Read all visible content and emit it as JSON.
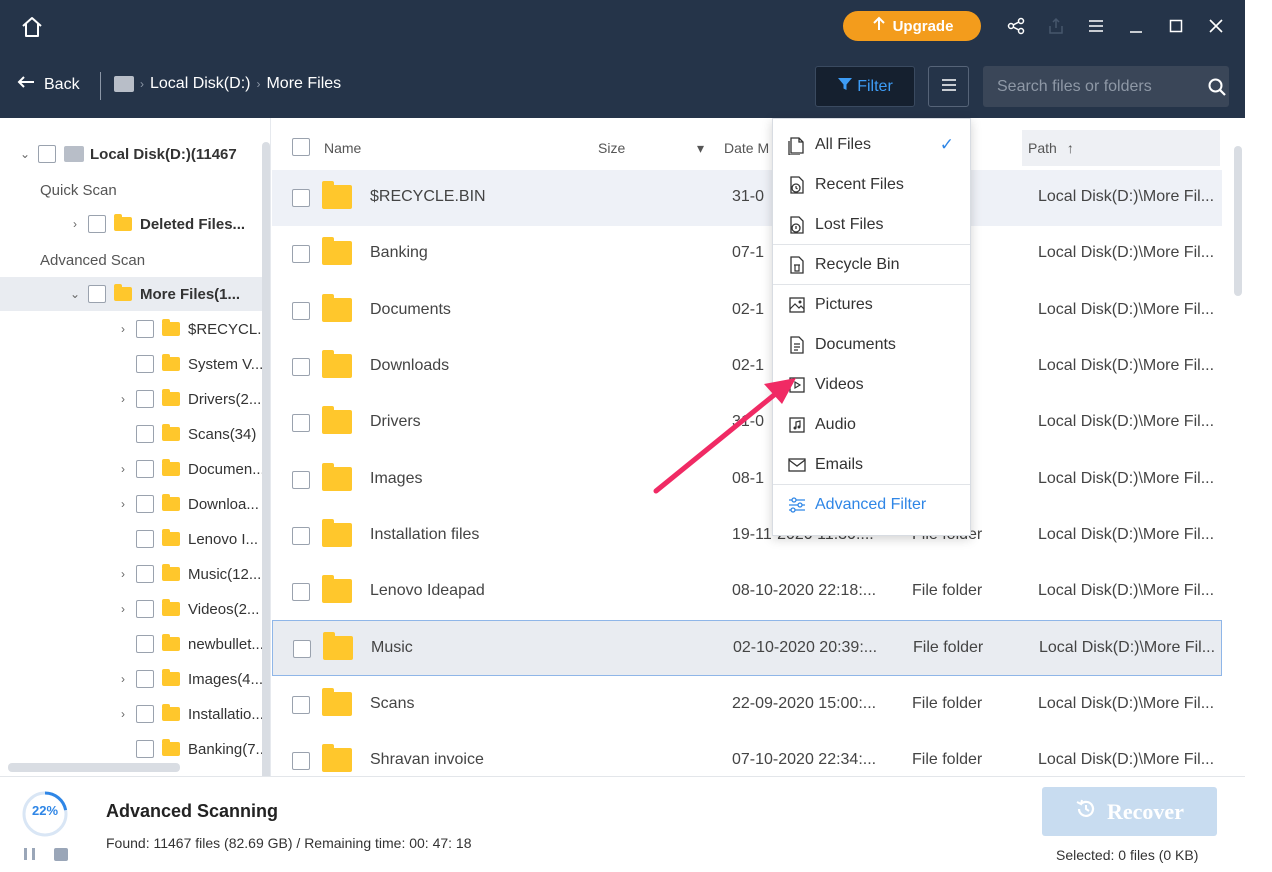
{
  "titlebar": {
    "upgrade_label": "Upgrade"
  },
  "navbar": {
    "back_label": "Back",
    "breadcrumb": [
      "Local Disk(D:)",
      "More Files"
    ],
    "filter_label": "Filter",
    "search_placeholder": "Search files or folders"
  },
  "tree": {
    "root_label": "Local Disk(D:)(11467",
    "quick_scan_label": "Quick Scan",
    "deleted_label": "Deleted Files...",
    "advanced_scan_label": "Advanced Scan",
    "more_files_label": "More Files(1...",
    "children": [
      {
        "label": "$RECYCL...",
        "expandable": true
      },
      {
        "label": "System V...",
        "expandable": false
      },
      {
        "label": "Drivers(2...",
        "expandable": true
      },
      {
        "label": "Scans(34)",
        "expandable": false
      },
      {
        "label": "Documen...",
        "expandable": true
      },
      {
        "label": "Downloa...",
        "expandable": true
      },
      {
        "label": "Lenovo I...",
        "expandable": false
      },
      {
        "label": "Music(12...",
        "expandable": true
      },
      {
        "label": "Videos(2...",
        "expandable": true
      },
      {
        "label": "newbullet...",
        "expandable": false
      },
      {
        "label": "Images(4...",
        "expandable": true
      },
      {
        "label": "Installatio...",
        "expandable": true
      },
      {
        "label": "Banking(7...",
        "expandable": false
      }
    ]
  },
  "table": {
    "headers": {
      "name": "Name",
      "size": "Size",
      "date": "Date M",
      "path": "Path"
    },
    "rows": [
      {
        "name": "$RECYCLE.BIN",
        "date": "31-0",
        "type": "er",
        "path": "Local Disk(D:)\\More Fil..."
      },
      {
        "name": "Banking",
        "date": "07-1",
        "type": "er",
        "path": "Local Disk(D:)\\More Fil..."
      },
      {
        "name": "Documents",
        "date": "02-1",
        "type": "er",
        "path": "Local Disk(D:)\\More Fil..."
      },
      {
        "name": "Downloads",
        "date": "02-1",
        "type": "er",
        "path": "Local Disk(D:)\\More Fil..."
      },
      {
        "name": "Drivers",
        "date": "31-0",
        "type": "er",
        "path": "Local Disk(D:)\\More Fil..."
      },
      {
        "name": "Images",
        "date": "08-1",
        "type": "er",
        "path": "Local Disk(D:)\\More Fil..."
      },
      {
        "name": "Installation files",
        "date": "19-11-2020 11:30:...",
        "type": "File folder",
        "path": "Local Disk(D:)\\More Fil..."
      },
      {
        "name": "Lenovo Ideapad",
        "date": "08-10-2020 22:18:...",
        "type": "File folder",
        "path": "Local Disk(D:)\\More Fil..."
      },
      {
        "name": "Music",
        "date": "02-10-2020 20:39:...",
        "type": "File folder",
        "path": "Local Disk(D:)\\More Fil..."
      },
      {
        "name": "Scans",
        "date": "22-09-2020 15:00:...",
        "type": "File folder",
        "path": "Local Disk(D:)\\More Fil..."
      },
      {
        "name": "Shravan invoice",
        "date": "07-10-2020 22:34:...",
        "type": "File folder",
        "path": "Local Disk(D:)\\More Fil..."
      }
    ]
  },
  "filter_menu": {
    "items": [
      {
        "label": "All Files",
        "icon": "all-files-icon",
        "checked": true
      },
      {
        "label": "Recent Files",
        "icon": "recent-files-icon"
      },
      {
        "label": "Lost Files",
        "icon": "lost-files-icon"
      },
      {
        "label": "Recycle Bin",
        "icon": "recycle-bin-icon"
      },
      {
        "label": "Pictures",
        "icon": "pictures-icon"
      },
      {
        "label": "Documents",
        "icon": "documents-icon"
      },
      {
        "label": "Videos",
        "icon": "videos-icon"
      },
      {
        "label": "Audio",
        "icon": "audio-icon"
      },
      {
        "label": "Emails",
        "icon": "emails-icon"
      }
    ],
    "advanced_label": "Advanced Filter"
  },
  "bottom": {
    "progress_text": "22%",
    "progress_value": 0.22,
    "scan_title": "Advanced Scanning",
    "found_text": "Found: 11467 files (82.69 GB) / Remaining time: 00: 47: 18",
    "recover_label": "Recover",
    "selected_text": "Selected: 0 files (0 KB)"
  },
  "colors": {
    "header_bg": "#253449",
    "accent": "#2f86e6",
    "upgrade": "#f39c1c",
    "folder": "#ffc72c",
    "arrow": "#f02a64"
  }
}
